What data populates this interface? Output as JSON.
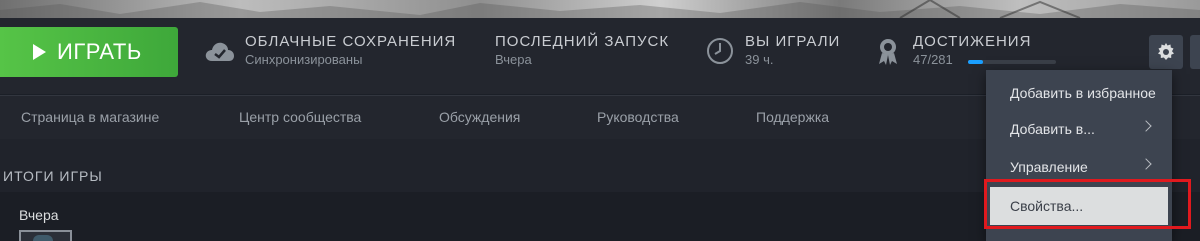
{
  "play": {
    "label": "ИГРАТЬ"
  },
  "stats": {
    "cloud": {
      "title": "ОБЛАЧНЫЕ СОХРАНЕНИЯ",
      "value": "Синхронизированы"
    },
    "last_launch": {
      "title": "ПОСЛЕДНИЙ ЗАПУСК",
      "value": "Вчера"
    },
    "played": {
      "title": "ВЫ ИГРАЛИ",
      "value": "39 ч."
    },
    "achievements": {
      "title": "ДОСТИЖЕНИЯ",
      "value": "47/281",
      "progress": 0.167
    }
  },
  "nav": {
    "items": [
      "Страница в магазине",
      "Центр сообщества",
      "Обсуждения",
      "Руководства",
      "Поддержка"
    ]
  },
  "section": {
    "title": "ИТОГИ ИГРЫ",
    "day": "Вчера"
  },
  "menu": {
    "items": [
      {
        "label": "Добавить в избранное",
        "submenu": false
      },
      {
        "label": "Добавить в...",
        "submenu": true
      },
      {
        "label": "Управление",
        "submenu": true
      },
      {
        "label": "Свойства...",
        "submenu": false
      }
    ]
  },
  "colors": {
    "accent_green": "#56c447",
    "progress_blue": "#1a9fff",
    "highlight_red": "#e0191e"
  }
}
